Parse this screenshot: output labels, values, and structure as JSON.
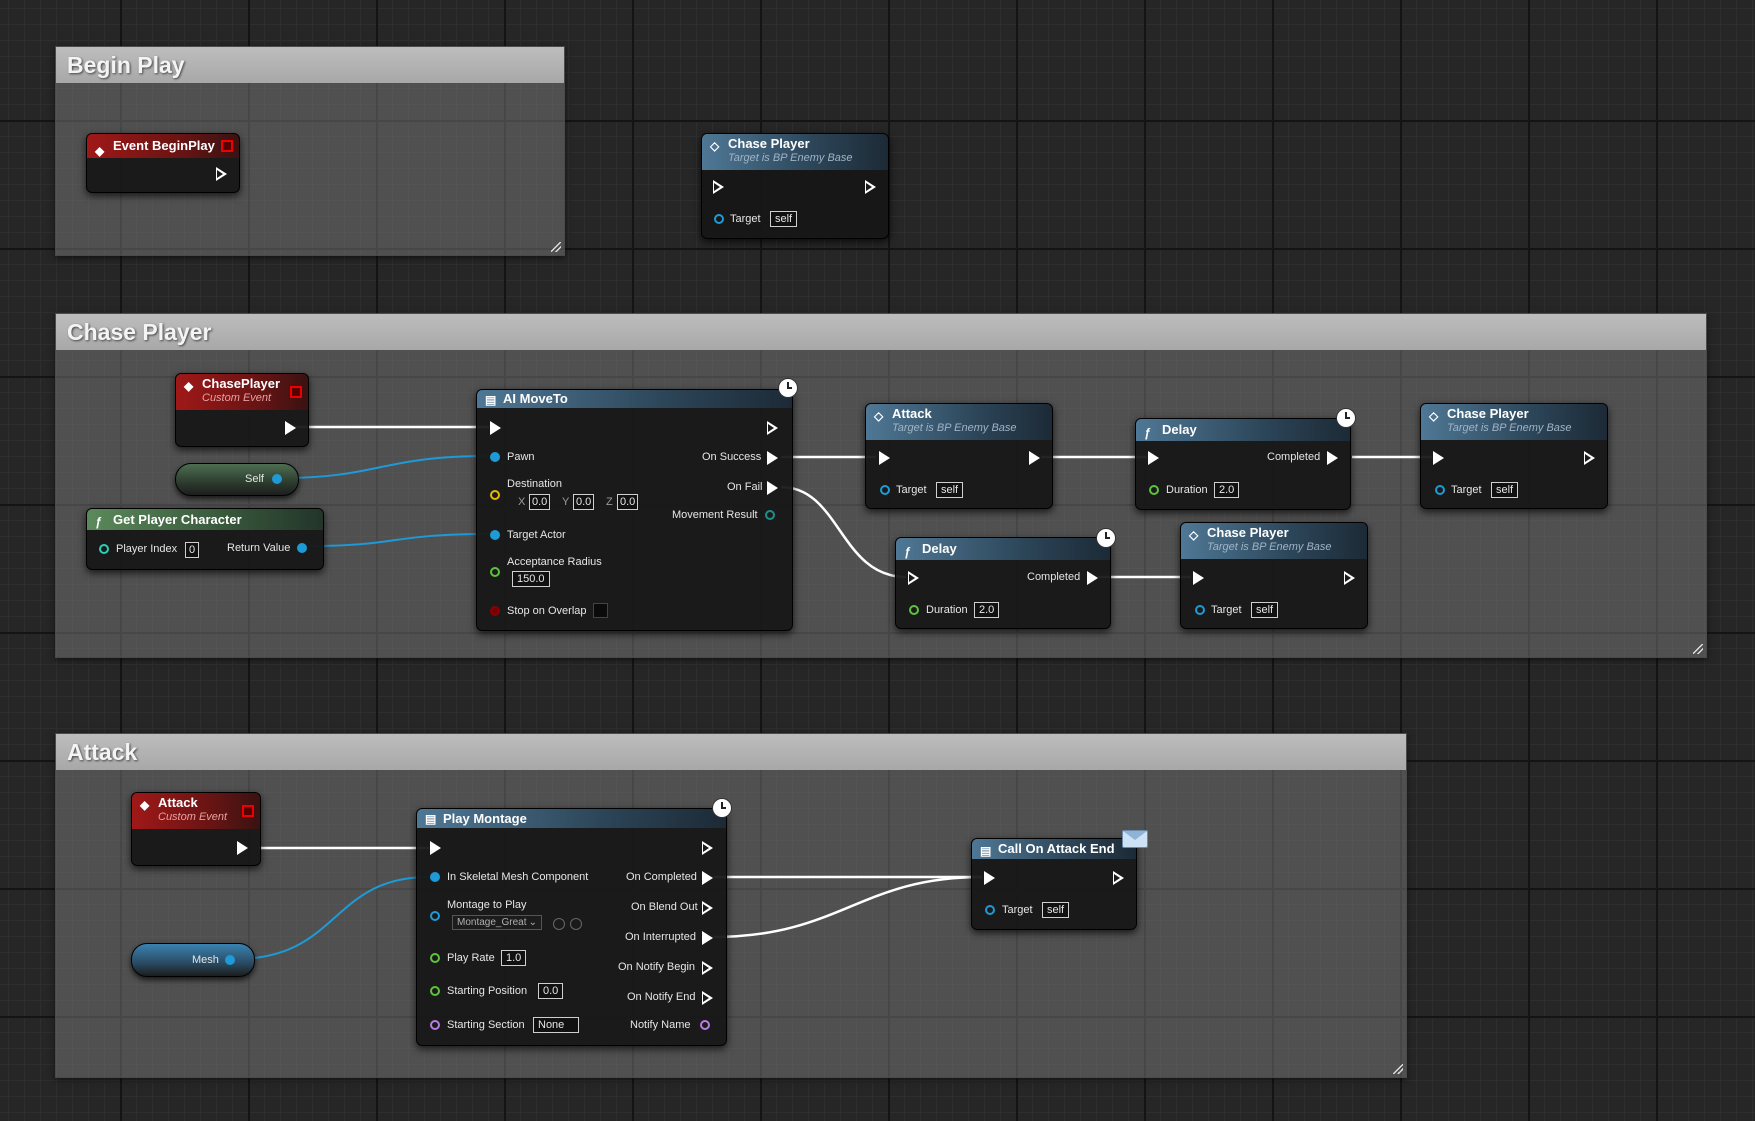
{
  "comments": {
    "begin_play": "Begin Play",
    "chase_player": "Chase Player",
    "attack": "Attack"
  },
  "nodes": {
    "event_beginplay": {
      "title": "Event BeginPlay"
    },
    "loose_chase": {
      "title": "Chase Player",
      "subtitle": "Target is BP Enemy Base",
      "target_label": "Target",
      "target_value": "self"
    },
    "chaseplayer_event": {
      "title": "ChasePlayer",
      "subtitle": "Custom Event"
    },
    "self_var": {
      "label": "Self"
    },
    "get_player_character": {
      "title": "Get Player Character",
      "player_index_label": "Player Index",
      "player_index_value": "0",
      "return_label": "Return Value"
    },
    "ai_moveto": {
      "title": "AI MoveTo",
      "pawn": "Pawn",
      "destination": "Destination",
      "dest_x_axis": "X",
      "dest_x": "0.0",
      "dest_y_axis": "Y",
      "dest_y": "0.0",
      "dest_z_axis": "Z",
      "dest_z": "0.0",
      "target_actor": "Target Actor",
      "acceptance_radius": "Acceptance Radius",
      "acceptance_radius_value": "150.0",
      "stop_on_overlap": "Stop on Overlap",
      "on_success": "On Success",
      "on_fail": "On Fail",
      "movement_result": "Movement Result"
    },
    "attack_call": {
      "title": "Attack",
      "subtitle": "Target is BP Enemy Base",
      "target_label": "Target",
      "target_value": "self"
    },
    "delay_top": {
      "title": "Delay",
      "completed": "Completed",
      "duration_label": "Duration",
      "duration_value": "2.0"
    },
    "chase_call_top": {
      "title": "Chase Player",
      "subtitle": "Target is BP Enemy Base",
      "target_label": "Target",
      "target_value": "self"
    },
    "delay_bottom": {
      "title": "Delay",
      "completed": "Completed",
      "duration_label": "Duration",
      "duration_value": "2.0"
    },
    "chase_call_bottom": {
      "title": "Chase Player",
      "subtitle": "Target is BP Enemy Base",
      "target_label": "Target",
      "target_value": "self"
    },
    "attack_event": {
      "title": "Attack",
      "subtitle": "Custom Event"
    },
    "mesh_var": {
      "label": "Mesh"
    },
    "play_montage": {
      "title": "Play Montage",
      "skeletal_mesh": "In Skeletal Mesh Component",
      "montage_to_play": "Montage to Play",
      "montage_value": "Montage_Great",
      "play_rate": "Play Rate",
      "play_rate_value": "1.0",
      "starting_position": "Starting Position",
      "starting_position_value": "0.0",
      "starting_section": "Starting Section",
      "starting_section_value": "None",
      "on_completed": "On Completed",
      "on_blend_out": "On Blend Out",
      "on_interrupted": "On Interrupted",
      "on_notify_begin": "On Notify Begin",
      "on_notify_end": "On Notify End",
      "notify_name": "Notify Name"
    },
    "call_on_attack_end": {
      "title": "Call On Attack End",
      "target_label": "Target",
      "target_value": "self"
    }
  },
  "colors": {
    "exec_wire": "#ffffff",
    "object_wire": "#1e9ad6",
    "event_header": "#a01818",
    "function_header": "#4f7896",
    "pure_header": "#5b8a5b"
  }
}
